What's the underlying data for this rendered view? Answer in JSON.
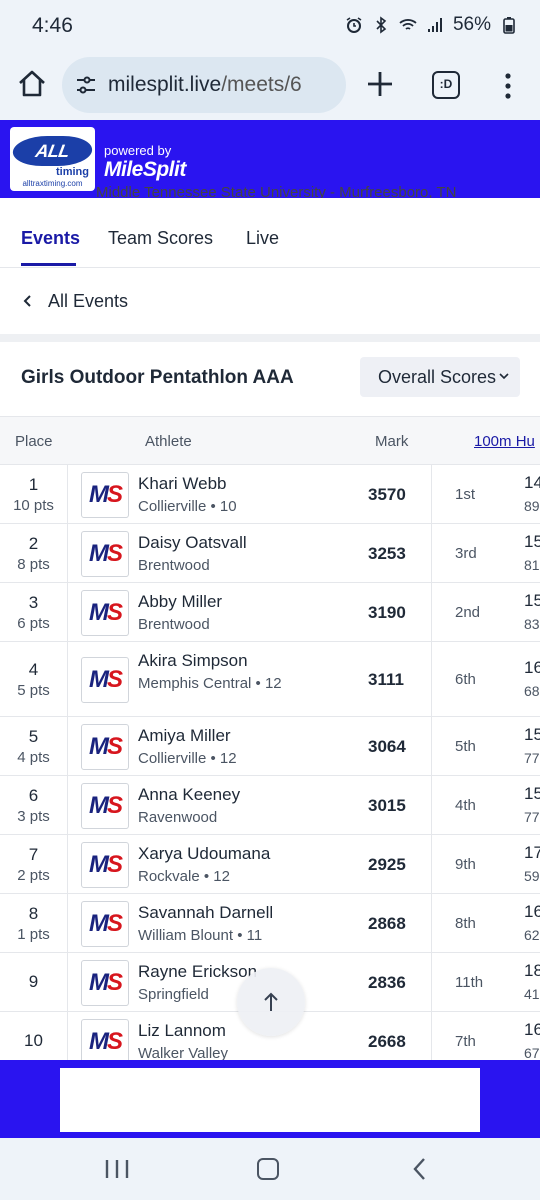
{
  "status_bar": {
    "time": "4:46",
    "battery": "56%"
  },
  "browser": {
    "url_host": "milesplit.live",
    "url_path": "/meets/6",
    "tabs_label": ":D"
  },
  "banner": {
    "logo_line1": "ALL TRAX",
    "logo_line2": "timing",
    "logo_line3": "alltraxtiming.com",
    "powered_by": "powered by",
    "brand": "MileSplit"
  },
  "venue_partial": "Middle Tennessee State University - Murfreesboro, TN",
  "tabs": [
    {
      "label": "Events"
    },
    {
      "label": "Team Scores"
    },
    {
      "label": "Live"
    }
  ],
  "back": {
    "label": "All Events"
  },
  "event": {
    "title": "Girls Outdoor Pentathlon AAA",
    "scores_select": "Overall Scores"
  },
  "table": {
    "headers": {
      "place": "Place",
      "athlete": "Athlete",
      "mark": "Mark",
      "event": "100m Hu"
    },
    "rows": [
      {
        "place": "1",
        "pts": "10 pts",
        "name": "Khari Webb",
        "school": "Collierville • 10",
        "mark": "3570",
        "ev_place": "1st",
        "ev_time": "14",
        "ev_pts": "89"
      },
      {
        "place": "2",
        "pts": "8 pts",
        "name": "Daisy Oatsvall",
        "school": "Brentwood",
        "mark": "3253",
        "ev_place": "3rd",
        "ev_time": "15",
        "ev_pts": "81"
      },
      {
        "place": "3",
        "pts": "6 pts",
        "name": "Abby Miller",
        "school": "Brentwood",
        "mark": "3190",
        "ev_place": "2nd",
        "ev_time": "15",
        "ev_pts": "83"
      },
      {
        "place": "4",
        "pts": "5 pts",
        "name": "Akira Simpson",
        "school": "Memphis Central • 12",
        "mark": "3111",
        "ev_place": "6th",
        "ev_time": "16",
        "ev_pts": "68"
      },
      {
        "place": "5",
        "pts": "4 pts",
        "name": "Amiya Miller",
        "school": "Collierville • 12",
        "mark": "3064",
        "ev_place": "5th",
        "ev_time": "15",
        "ev_pts": "77"
      },
      {
        "place": "6",
        "pts": "3 pts",
        "name": "Anna Keeney",
        "school": "Ravenwood",
        "mark": "3015",
        "ev_place": "4th",
        "ev_time": "15",
        "ev_pts": "77"
      },
      {
        "place": "7",
        "pts": "2 pts",
        "name": "Xarya Udoumana",
        "school": "Rockvale • 12",
        "mark": "2925",
        "ev_place": "9th",
        "ev_time": "17",
        "ev_pts": "59"
      },
      {
        "place": "8",
        "pts": "1 pts",
        "name": "Savannah Darnell",
        "school": "William Blount • 11",
        "mark": "2868",
        "ev_place": "8th",
        "ev_time": "16",
        "ev_pts": "62"
      },
      {
        "place": "9",
        "pts": "",
        "name": "Rayne Erickson",
        "school": "Springfield",
        "mark": "2836",
        "ev_place": "11th",
        "ev_time": "18",
        "ev_pts": "41"
      },
      {
        "place": "10",
        "pts": "",
        "name": "Liz Lannom",
        "school": "Walker Valley",
        "mark": "2668",
        "ev_place": "7th",
        "ev_time": "16",
        "ev_pts": "67"
      }
    ]
  },
  "row_logo": {
    "m": "M",
    "s": "S"
  },
  "colors": {
    "brand_blue": "#2a14f0",
    "active_tab": "#1a1aa6",
    "ms_red": "#d7161e"
  }
}
